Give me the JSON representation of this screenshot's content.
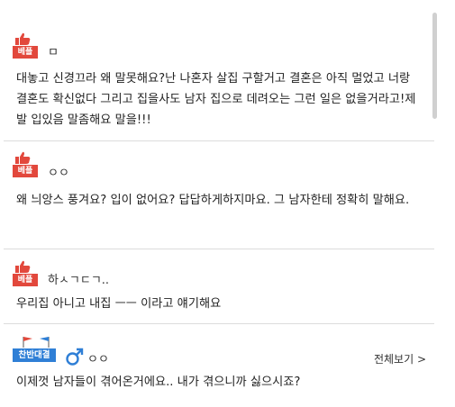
{
  "comments": [
    {
      "badge": "베플",
      "author": "ㅁ",
      "text": "대놓고 신경끄라 왜 말못해요?난 나혼자 살집 구할거고 결혼은 아직 멀었고 너랑 결혼도 확신없다 그리고 집을사도 남자 집으로 데려오는 그런 일은 없을거라고!제발 입있음 말좀해요 말을!!!"
    },
    {
      "badge": "베플",
      "author": "ㅇㅇ",
      "text": "왜 늬앙스 풍겨요? 입이 없어요? 답답하게하지마요. 그 남자한테 정확히 말해요."
    },
    {
      "badge": "베플",
      "author": "하ㅅㄱㄷㄱ..",
      "text": "우리집 아니고 내집 ㅡㅡ 이라고 얘기해요"
    }
  ],
  "debate": {
    "badge": "찬반대결",
    "gender_icon": "male-icon",
    "author": "ㅇㅇ",
    "more_label": "전체보기 >",
    "text": "이제껏 남자들이 겪어온거에요.. 내가 겪으니까 싫으시죠?"
  },
  "colors": {
    "best_badge": "#e2483c",
    "debate_badge": "#2f7fd6",
    "male_icon": "#2f7fd6",
    "divider": "#dcdcdc"
  }
}
